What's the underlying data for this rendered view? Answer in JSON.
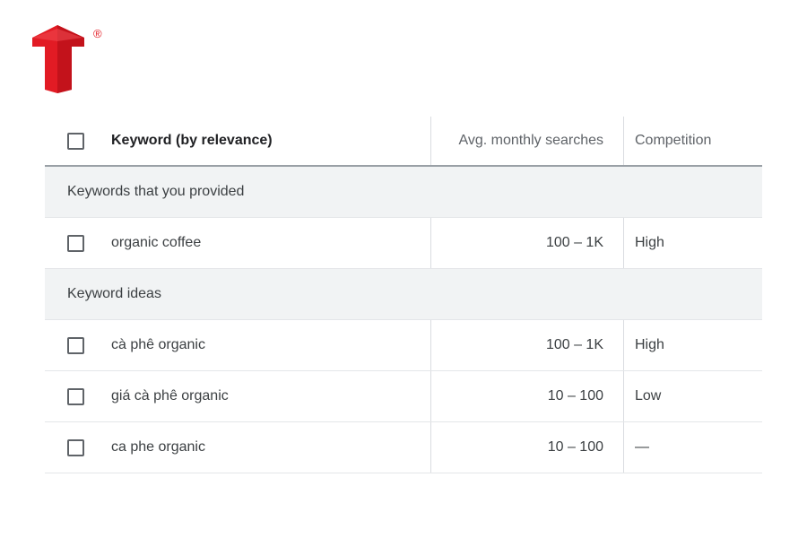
{
  "brand": {
    "logo_icon": "red-t-logo-icon",
    "registered_mark": "®",
    "color": "#e21b24"
  },
  "table": {
    "columns": {
      "keyword": "Keyword (by relevance)",
      "avg_monthly_searches": "Avg. monthly searches",
      "competition": "Competition"
    },
    "groups": [
      {
        "label": "Keywords that you provided",
        "rows": [
          {
            "keyword": "organic coffee",
            "avg": "100 – 1K",
            "competition": "High"
          }
        ]
      },
      {
        "label": "Keyword ideas",
        "rows": [
          {
            "keyword": "cà phê organic",
            "avg": "100 – 1K",
            "competition": "High"
          },
          {
            "keyword": "giá cà phê organic",
            "avg": "10 – 100",
            "competition": "Low"
          },
          {
            "keyword": "ca phe organic",
            "avg": "10 – 100",
            "competition": "—"
          }
        ]
      }
    ]
  }
}
